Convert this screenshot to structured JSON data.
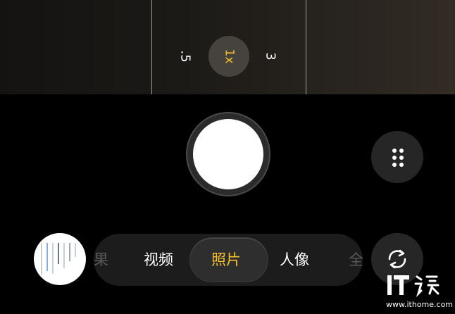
{
  "zoom": {
    "options": [
      ".5",
      "1x",
      "3"
    ],
    "selected": "1x"
  },
  "modes": {
    "prev_partial": "果",
    "video": "视频",
    "photo": "照片",
    "portrait": "人像",
    "next_partial": "全",
    "selected": "照片"
  },
  "watermark": {
    "url": "www.ithome.com"
  },
  "colors": {
    "accent": "#f5c12e",
    "background": "#000000"
  },
  "icons": {
    "more": "grid-dots-icon",
    "flip": "flip-camera-icon",
    "shutter": "shutter-button"
  }
}
